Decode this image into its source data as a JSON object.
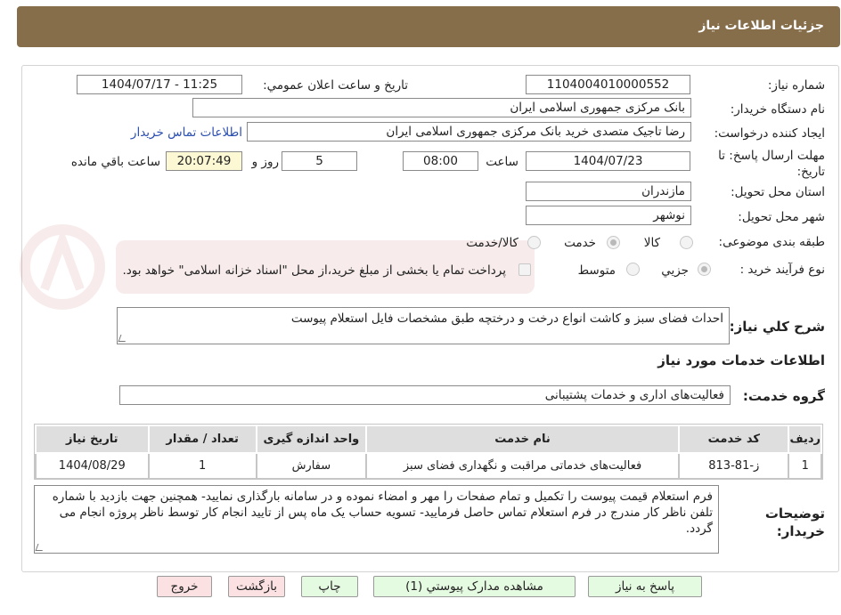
{
  "header": {
    "title": "جزئیات اطلاعات نیاز"
  },
  "form": {
    "need_number_label": "شماره نیاز:",
    "need_number": "1104004010000552",
    "announce_label": "تاریخ و ساعت اعلان عمومي:",
    "announce_value": "1404/07/17 - 11:25",
    "buyer_org_label": "نام دستگاه خريدار:",
    "buyer_org": "بانک مرکزی جمهوری اسلامی ایران",
    "requester_label": "ايجاد کننده درخواست:",
    "requester": "رضا تاجیک متصدی خرید بانک مرکزی جمهوری اسلامی ایران",
    "contact_link": "اطلاعات تماس خريدار",
    "deadline_label": "مهلت ارسال پاسخ: تا تاریخ:",
    "deadline_date": "1404/07/23",
    "time_label": "ساعت",
    "deadline_time": "08:00",
    "days": "5",
    "days_label": "روز و",
    "remaining_time": "20:07:49",
    "remaining_label": "ساعت باقي مانده",
    "province_label": "استان محل تحویل:",
    "province": "مازندران",
    "city_label": "شهر محل تحویل:",
    "city": "نوشهر",
    "category_label": "طبقه بندی موضوعی:",
    "category_options": [
      "کالا",
      "خدمت",
      "کالا/خدمت"
    ],
    "category_selected": "خدمت",
    "process_label": "نوع فرآیند خرید :",
    "process_options": [
      "جزیي",
      "متوسط"
    ],
    "process_selected": "جزیي",
    "treasury_note": "پرداخت تمام یا بخشی از مبلغ خرید،از محل \"اسناد خزانه اسلامی\" خواهد بود."
  },
  "summary": {
    "label": "شرح كلي نياز:",
    "text": "احداث فضای سبز و کاشت انواع درخت و درختچه طبق مشخصات فایل استعلام پیوست"
  },
  "services": {
    "section_title": "اطلاعات خدمات مورد نياز",
    "group_label": "گروه خدمت:",
    "group_value": "فعالیت‌های اداری و خدمات پشتیبانی",
    "columns": [
      "رديف",
      "کد خدمت",
      "نام خدمت",
      "واحد اندازه گيری",
      "تعداد / مقدار",
      "تاريخ نياز"
    ],
    "rows": [
      [
        "1",
        "ز-81-813",
        "فعالیت‌های خدماتی مراقبت و نگهداری فضای سبز",
        "سفارش",
        "1",
        "1404/08/29"
      ]
    ]
  },
  "buyer_notes": {
    "label": "توضيحات خريدار:",
    "text": "فرم استعلام قیمت پیوست را تکمیل و تمام صفحات را مهر و امضاء نموده و در سامانه بارگذاری نمایید- همچنین جهت بازدید با شماره تلفن ناظر کار مندرج در فرم استعلام تماس حاصل فرمایید- تسویه حساب یک ماه پس از تایید انجام کار توسط ناظر پروژه انجام می گردد."
  },
  "buttons": {
    "reply": "پاسخ به نياز",
    "attachments": "مشاهده مدارک پيوستي (1)",
    "print": "چاپ",
    "back": "بازگشت",
    "exit": "خروج"
  }
}
